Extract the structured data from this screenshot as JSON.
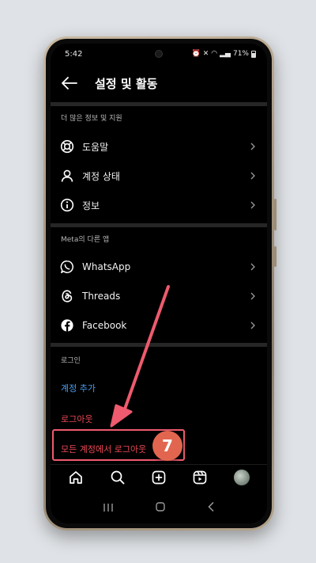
{
  "status_bar": {
    "time": "5:42",
    "battery": "71%"
  },
  "header": {
    "title": "설정 및 활동"
  },
  "sections": [
    {
      "label": "더 많은 정보 및 지원",
      "items": [
        {
          "label": "도움말",
          "icon": "lifebuoy-icon"
        },
        {
          "label": "계정 상태",
          "icon": "person-icon"
        },
        {
          "label": "정보",
          "icon": "info-icon"
        }
      ]
    },
    {
      "label": "Meta의 다른 앱",
      "items": [
        {
          "label": "WhatsApp",
          "icon": "whatsapp-icon"
        },
        {
          "label": "Threads",
          "icon": "threads-icon"
        },
        {
          "label": "Facebook",
          "icon": "facebook-icon"
        }
      ]
    }
  ],
  "login": {
    "label": "로그인",
    "add_account": "계정 추가",
    "logout": "로그아웃",
    "logout_all": "모든 계정에서 로그아웃"
  },
  "annotation": {
    "step": "7"
  },
  "colors": {
    "link_blue": "#4a9df0",
    "logout_red": "#ed4956",
    "annotation": "#ee5a6e",
    "badge": "#e2664f"
  }
}
